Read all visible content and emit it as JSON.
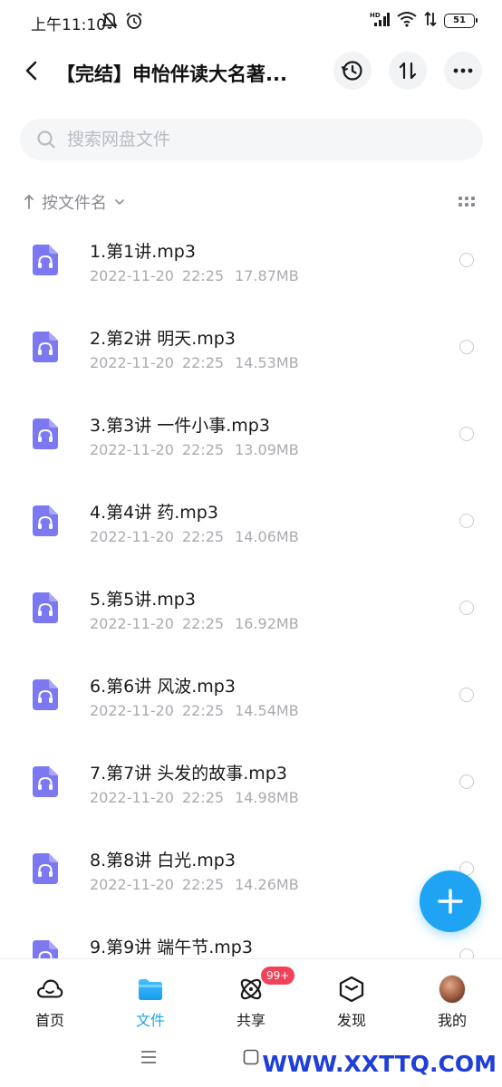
{
  "status_bar": {
    "time": "上午11:10",
    "battery": "51"
  },
  "header": {
    "title": "【完结】申怡伴读大名著..."
  },
  "search": {
    "placeholder": "搜索网盘文件"
  },
  "sort": {
    "label": "按文件名"
  },
  "files": [
    {
      "name": "1.第1讲.mp3",
      "date": "2022-11-20",
      "time": "22:25",
      "size": "17.87MB"
    },
    {
      "name": "2.第2讲 明天.mp3",
      "date": "2022-11-20",
      "time": "22:25",
      "size": "14.53MB"
    },
    {
      "name": "3.第3讲 一件小事.mp3",
      "date": "2022-11-20",
      "time": "22:25",
      "size": "13.09MB"
    },
    {
      "name": "4.第4讲 药.mp3",
      "date": "2022-11-20",
      "time": "22:25",
      "size": "14.06MB"
    },
    {
      "name": "5.第5讲.mp3",
      "date": "2022-11-20",
      "time": "22:25",
      "size": "16.92MB"
    },
    {
      "name": "6.第6讲 风波.mp3",
      "date": "2022-11-20",
      "time": "22:25",
      "size": "14.54MB"
    },
    {
      "name": "7.第7讲 头发的故事.mp3",
      "date": "2022-11-20",
      "time": "22:25",
      "size": "14.98MB"
    },
    {
      "name": "8.第8讲 白光.mp3",
      "date": "2022-11-20",
      "time": "22:25",
      "size": "14.26MB"
    },
    {
      "name": "9.第9讲 端午节.mp3",
      "date": "",
      "time": "",
      "size": ""
    }
  ],
  "tabs": [
    {
      "label": "首页",
      "icon": "cloud-icon"
    },
    {
      "label": "文件",
      "icon": "folder-icon",
      "active": true
    },
    {
      "label": "共享",
      "icon": "atom-icon",
      "badge": "99+"
    },
    {
      "label": "发现",
      "icon": "cube-icon"
    },
    {
      "label": "我的",
      "icon": "avatar"
    }
  ],
  "watermark": "WWW.XXTTQ.COM",
  "colors": {
    "accent": "#1ea4f3",
    "file_icon": "#7b78f2",
    "badge": "#f0435a",
    "watermark": "#1f3fd8"
  }
}
